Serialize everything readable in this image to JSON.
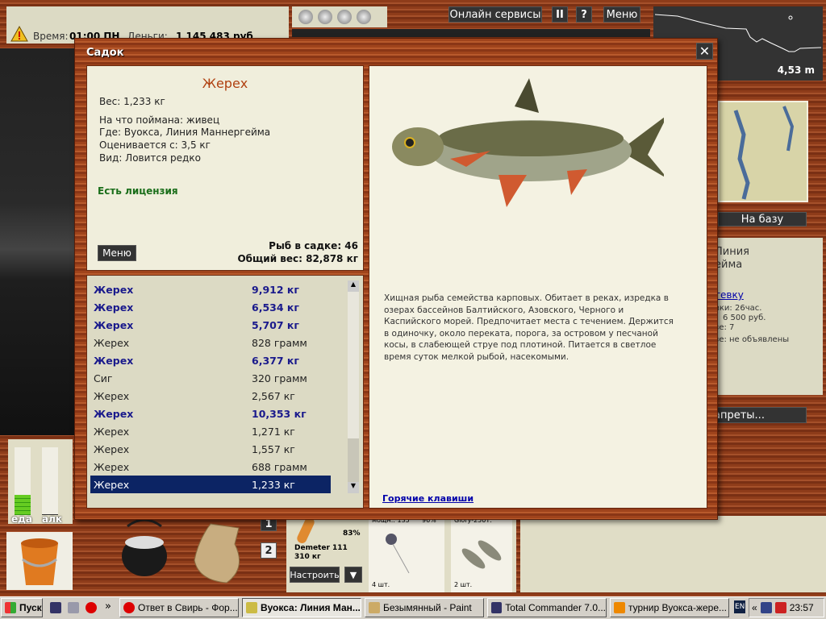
{
  "hud": {
    "time_label": "Время:",
    "time_value": "01:00 ПН",
    "money_label": "Деньги:",
    "money_value": "1 145 483 руб"
  },
  "top_buttons": {
    "online": "Онлайн сервисы",
    "pause": "II",
    "help": "?",
    "menu": "Меню"
  },
  "depth": {
    "value": "4,53 m"
  },
  "map": {
    "to_base": "На базу"
  },
  "location_panel": {
    "line1": "Линия",
    "line2": "ейма",
    "link": "тевку",
    "info1": "вки: 26час.",
    "info2": "6 500 руб.",
    "info3": "зе: 7",
    "info4": "зе: не объявлены",
    "bans_button": "апреты..."
  },
  "meters": {
    "food_label": "еда",
    "alc_label": "алк",
    "food_level": 0.3,
    "alc_level": 0.0
  },
  "slots": [
    "1",
    "2"
  ],
  "tackle": {
    "rod_name": "Demeter 111",
    "rod_load": "310 кг",
    "percent": "83%",
    "line_info": "мощн.: 135",
    "line_pct": "96%",
    "reel": "Glory-250Т:",
    "hook_count": "4 шт.",
    "bait_count": "2 шт.",
    "setup_button": "Настроить",
    "dropdown": "▼"
  },
  "dialog": {
    "title": "Садок",
    "close": "✕",
    "fish": {
      "name": "Жерех",
      "weight": "Вес: 1,233 кг",
      "bait": "На что поймана: живец",
      "where": "Где: Вуокса, Линия Маннергейма",
      "price": "Оценивается с: 3,5 кг",
      "kind": "Вид: Ловится редко",
      "license": "Есть лицензия"
    },
    "menu_button": "Меню",
    "count": "Рыб в садке: 46",
    "total": "Общий вес: 82,878 кг",
    "list": [
      {
        "name": "Жерех",
        "weight": "9,912 кг",
        "big": true
      },
      {
        "name": "Жерех",
        "weight": "6,534 кг",
        "big": true
      },
      {
        "name": "Жерех",
        "weight": "5,707 кг",
        "big": true
      },
      {
        "name": "Жерех",
        "weight": "828 грамм",
        "big": false
      },
      {
        "name": "Жерех",
        "weight": "6,377 кг",
        "big": true
      },
      {
        "name": "Сиг",
        "weight": "320 грамм",
        "big": false
      },
      {
        "name": "Жерех",
        "weight": "2,567 кг",
        "big": false
      },
      {
        "name": "Жерех",
        "weight": "10,353 кг",
        "big": true
      },
      {
        "name": "Жерех",
        "weight": "1,271 кг",
        "big": false
      },
      {
        "name": "Жерех",
        "weight": "1,557 кг",
        "big": false
      },
      {
        "name": "Жерех",
        "weight": "688 грамм",
        "big": false
      },
      {
        "name": "Жерех",
        "weight": "1,233 кг",
        "big": false,
        "selected": true
      }
    ],
    "description": "Хищная рыба семейства карповых. Обитает в реках, изредка в озерах бассейнов Балтийского, Азовского, Черного и Каспийского морей. Предпочитает места с течением. Держится в одиночку, около переката, порога, за островом у песчаной косы, в слабеющей струе под плотиной. Питается в светлое время суток мелкой рыбой, насекомыми.",
    "hotkeys": "Горячие клавиши"
  },
  "taskbar": {
    "start": "Пуск",
    "more": "»",
    "tasks": [
      "Ответ в Свирь - Фор...",
      "Вуокса: Линия Ман...",
      "Безымянный - Paint",
      "Total Commander 7.0...",
      "турнир Вуокса-жере..."
    ],
    "lang": "EN",
    "tray_more": "«",
    "clock": "23:57"
  },
  "colors": {
    "wood": "#9a4420",
    "panel": "#dcdac4",
    "selected": "#0c2464",
    "big_fish": "#1a1a8c",
    "license": "#1a6e1a",
    "title": "#b04010"
  }
}
